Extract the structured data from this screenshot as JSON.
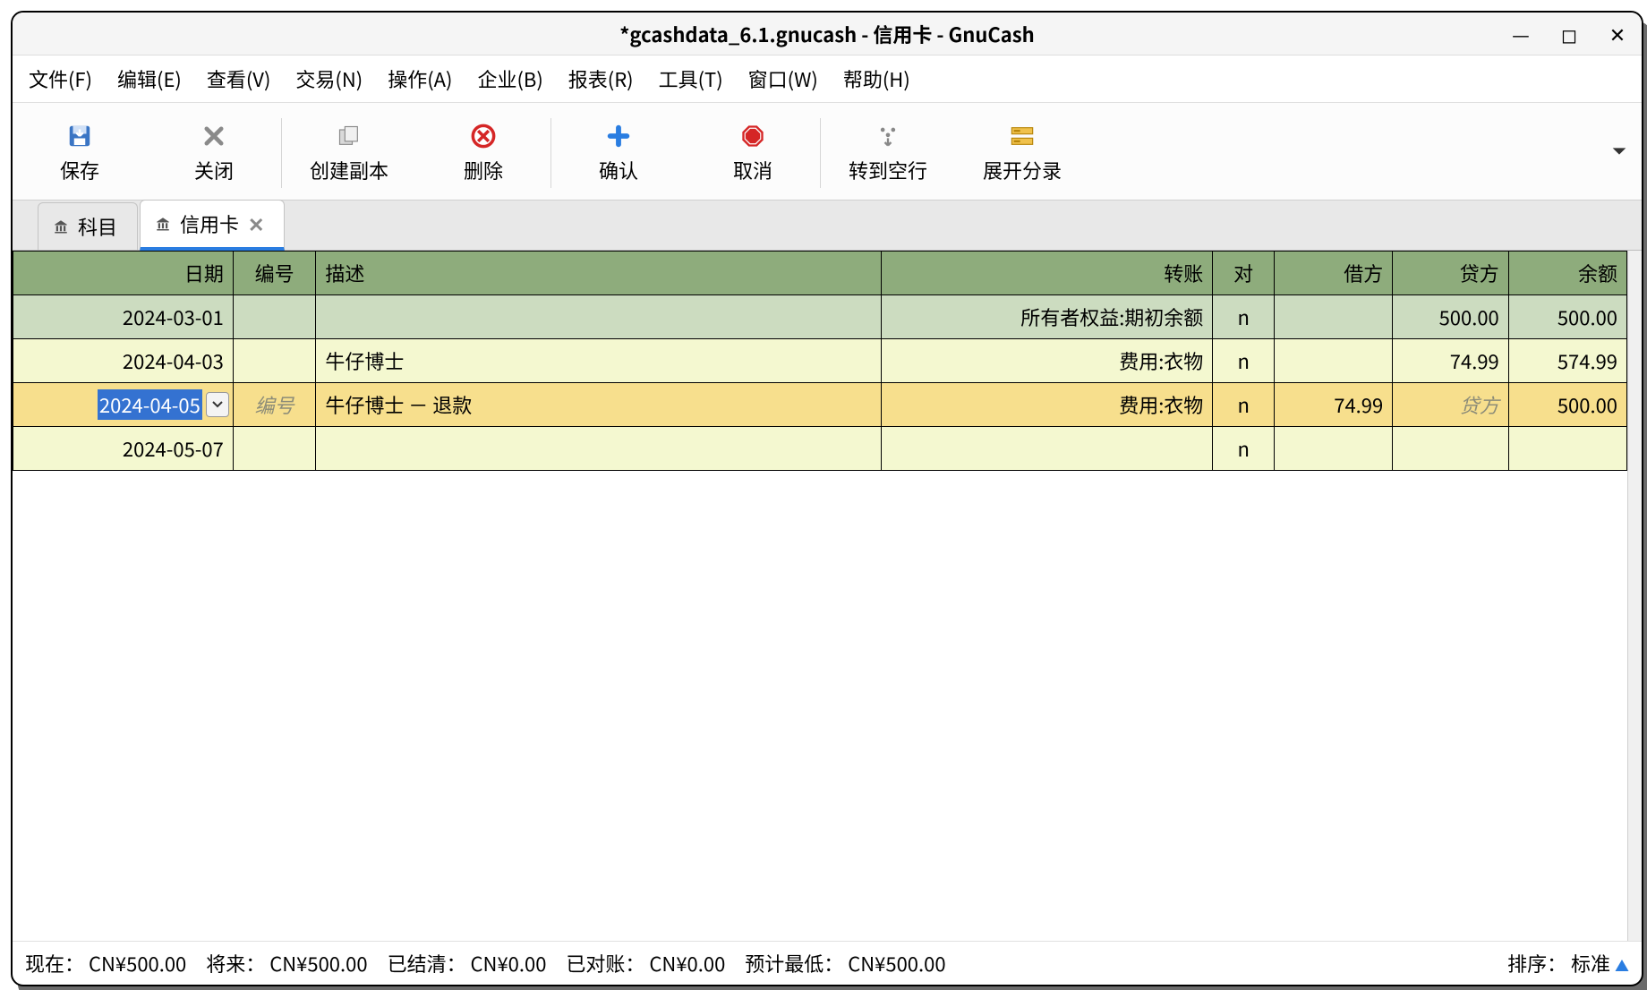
{
  "window": {
    "title": "*gcashdata_6.1.gnucash - 信用卡 - GnuCash"
  },
  "menu": {
    "items": [
      "文件(F)",
      "编辑(E)",
      "查看(V)",
      "交易(N)",
      "操作(A)",
      "企业(B)",
      "报表(R)",
      "工具(T)",
      "窗口(W)",
      "帮助(H)"
    ]
  },
  "toolbar": {
    "save": "保存",
    "close": "关闭",
    "duplicate": "创建副本",
    "delete": "删除",
    "enter": "确认",
    "cancel": "取消",
    "goblank": "转到空行",
    "splits": "展开分录"
  },
  "tabs": {
    "accounts": "科目",
    "credit": "信用卡"
  },
  "columns": {
    "date": "日期",
    "num": "编号",
    "desc": "描述",
    "transfer": "转账",
    "rec": "对",
    "debit": "借方",
    "credit": "贷方",
    "balance": "余额"
  },
  "rows": [
    {
      "date": "2024-03-01",
      "num": "",
      "desc": "",
      "transfer": "所有者权益:期初余额",
      "rec": "n",
      "deb": "",
      "cred": "500.00",
      "bal": "500.00"
    },
    {
      "date": "2024-04-03",
      "num": "",
      "desc": "牛仔博士",
      "transfer": "费用:衣物",
      "rec": "n",
      "deb": "",
      "cred": "74.99",
      "bal": "574.99"
    },
    {
      "date": "2024-04-05",
      "num_ph": "编号",
      "desc": "牛仔博士 － 退款",
      "transfer": "费用:衣物",
      "rec": "n",
      "deb": "74.99",
      "cred_ph": "贷方",
      "bal": "500.00"
    },
    {
      "date": "2024-05-07",
      "num": "",
      "desc": "",
      "transfer": "",
      "rec": "n",
      "deb": "",
      "cred": "",
      "bal": ""
    }
  ],
  "status": {
    "present_label": "现在：",
    "present": "CN¥500.00",
    "future_label": "将来：",
    "future": "CN¥500.00",
    "cleared_label": "已结清：",
    "cleared": "CN¥0.00",
    "reconciled_label": "已对账：",
    "reconciled": "CN¥0.00",
    "projmin_label": "预计最低：",
    "projmin": "CN¥500.00",
    "sort_label": "排序：",
    "sort": "标准"
  }
}
